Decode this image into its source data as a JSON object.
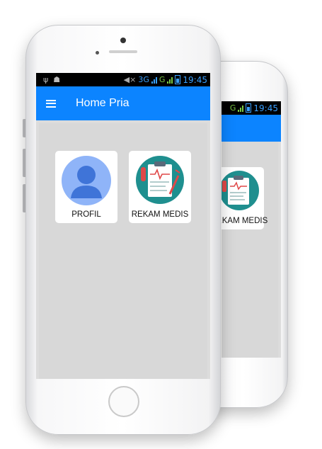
{
  "status_bar": {
    "usb_icon": "usb-icon",
    "android_icon": "android-debug-icon",
    "network_label": "3G",
    "network_secondary": "G",
    "time": "19:45"
  },
  "back_status_bar": {
    "network_secondary": "G",
    "time": "19:45"
  },
  "app_bar": {
    "title": "Home Pria",
    "menu_icon": "hamburger-menu-icon"
  },
  "menu": [
    {
      "label": "PROFIL",
      "icon": "user-avatar-icon"
    },
    {
      "label": "REKAM MEDIS",
      "icon": "medical-record-clipboard-icon"
    }
  ],
  "back_menu": [
    {
      "label": "REKAM MEDIS",
      "icon": "medical-record-clipboard-icon"
    }
  ],
  "colors": {
    "primary": "#0c84ff",
    "background": "#d8d8d8",
    "avatar_circle": "#8fb4f8",
    "avatar_figure": "#3f74d8",
    "clipboard_circle": "#1f8f8f"
  }
}
